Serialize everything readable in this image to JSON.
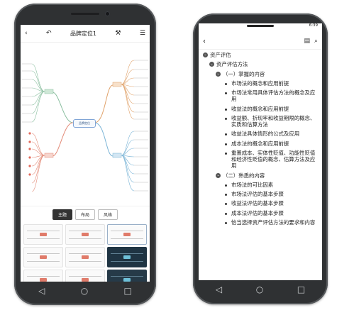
{
  "left_phone": {
    "title": "品牌定位1",
    "root_label": "品牌定位",
    "tabs": [
      "主题",
      "布局",
      "风格"
    ],
    "active_tab": "主题",
    "icons": [
      "back-icon",
      "undo-icon",
      "hammer-icon",
      "menu-icon"
    ],
    "nav": [
      "◁",
      "○",
      "□"
    ]
  },
  "right_phone": {
    "status": "6:39",
    "outline": [
      {
        "level": 1,
        "type": "toggle",
        "text": "资产评估"
      },
      {
        "level": 2,
        "type": "toggle",
        "text": "资产评估方法"
      },
      {
        "level": 3,
        "type": "toggle",
        "text": "（一）掌握的内容"
      },
      {
        "level": 4,
        "type": "bullet",
        "text": "市场法的概念和应用前提"
      },
      {
        "level": 4,
        "type": "bullet",
        "text": "市场法常用具体评估方法的概念及应用"
      },
      {
        "level": 4,
        "type": "bullet",
        "text": "收益法的概念和应用前提"
      },
      {
        "level": 4,
        "type": "bullet",
        "text": "收益额、折现率和收益期限的概念、实质和估算方法"
      },
      {
        "level": 4,
        "type": "bullet",
        "text": "收益法具体情形的公式及应用"
      },
      {
        "level": 4,
        "type": "bullet",
        "text": "成本法的概念和应用前提"
      },
      {
        "level": 4,
        "type": "bullet",
        "text": "重置成本、实体性贬值、功能性贬值和经济性贬值的概念、估算方法及应用"
      },
      {
        "level": 3,
        "type": "toggle",
        "text": "（二）熟悉的内容"
      },
      {
        "level": 4,
        "type": "bullet",
        "text": "市场法的可比因素"
      },
      {
        "level": 4,
        "type": "bullet",
        "text": "市场法评估的基本步骤"
      },
      {
        "level": 4,
        "type": "bullet",
        "text": "收益法评估的基本步骤"
      },
      {
        "level": 4,
        "type": "bullet",
        "text": "成本法评估的基本步骤"
      },
      {
        "level": 4,
        "type": "bullet",
        "text": "恰当选择资产评估方法的要求和内容"
      }
    ],
    "nav": [
      "◁",
      "○",
      "□"
    ]
  }
}
